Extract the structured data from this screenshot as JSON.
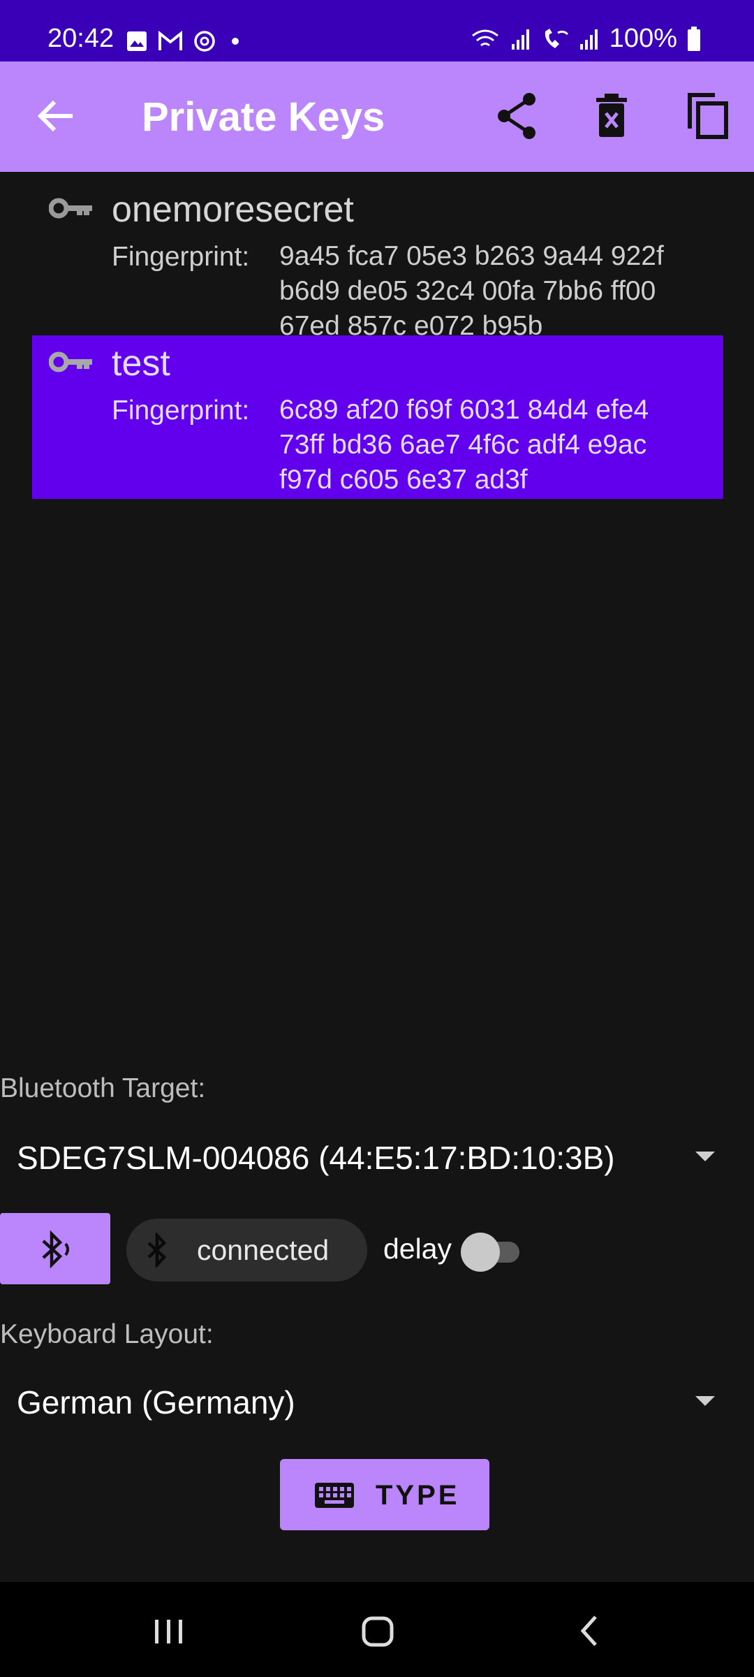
{
  "status_bar": {
    "time": "20:42",
    "battery": "100%",
    "notification_icons": [
      "image-icon",
      "gmail-icon",
      "sync-icon",
      "dot-icon"
    ],
    "system_icons": [
      "wifi-icon",
      "signal-icon",
      "wifi-calling-icon",
      "signal-icon",
      "battery-icon"
    ]
  },
  "app_bar": {
    "title": "Private Keys",
    "actions": [
      "share-icon",
      "delete-icon",
      "copy-icon"
    ],
    "color": "#bb86fc"
  },
  "keys": [
    {
      "name": "onemoresecret",
      "fingerprint_label": "Fingerprint:",
      "fingerprint_lines": [
        "9a45 fca7 05e3 b263 9a44 922f",
        "b6d9 de05 32c4 00fa 7bb6 ff00",
        "67ed 857c e072 b95b"
      ],
      "selected": false
    },
    {
      "name": "test",
      "fingerprint_label": "Fingerprint:",
      "fingerprint_lines": [
        "6c89 af20 f69f 6031 84d4 efe4",
        "73ff bd36 6ae7 4f6c adf4 e9ac",
        "f97d c605 6e37 ad3f"
      ],
      "selected": true
    }
  ],
  "bluetooth": {
    "label": "Bluetooth Target:",
    "selected_device": "SDEG7SLM-004086 (44:E5:17:BD:10:3B)",
    "status": "connected",
    "delay_label": "delay",
    "delay_enabled": false
  },
  "keyboard": {
    "label": "Keyboard Layout:",
    "selected_layout": "German (Germany)"
  },
  "type_button": {
    "label": "TYPE"
  },
  "colors": {
    "accent": "#bb86fc",
    "selected_row": "#6200ee",
    "status_bar": "#3a00b8",
    "background": "#141414"
  }
}
